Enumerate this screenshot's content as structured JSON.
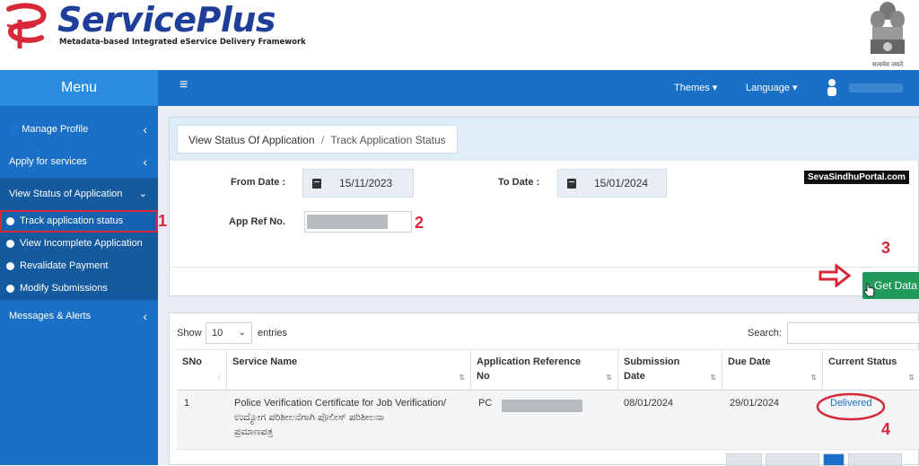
{
  "header": {
    "brand": "ServicePlus",
    "tagline": "Metadata-based Integrated eService Delivery Framework",
    "emblem_text": "सत्यमेव जयते"
  },
  "sidebar": {
    "title": "Menu",
    "items": [
      {
        "label": "Manage Profile"
      },
      {
        "label": "Apply for services"
      },
      {
        "label": "View Status of Application"
      },
      {
        "label": "Messages & Alerts"
      }
    ],
    "subitems": [
      {
        "label": "Track application status"
      },
      {
        "label": "View Incomplete Application"
      },
      {
        "label": "Revalidate Payment"
      },
      {
        "label": "Modify Submissions"
      }
    ]
  },
  "navbar": {
    "hamburger": "≡",
    "themes": "Themes ▾",
    "language": "Language ▾"
  },
  "breadcrumb": {
    "parent": "View Status Of Application",
    "separator": "/",
    "current": "Track Application Status"
  },
  "form": {
    "from_date_label": "From Date :",
    "from_date_value": "15/11/2023",
    "to_date_label": "To Date :",
    "to_date_value": "15/01/2024",
    "app_ref_label": "App Ref No.",
    "get_data_label": "Get Data"
  },
  "annotations": {
    "n1": "1",
    "n2": "2",
    "n3": "3",
    "n4": "4",
    "watermark": "SevaSindhuPortal.com",
    "color": "#d62839"
  },
  "table": {
    "show_label": "Show",
    "entries_value": "10",
    "entries_label": "entries",
    "search_label": "Search:",
    "headers": {
      "sno": "SNo",
      "service": "Service Name",
      "appref_line1": "Application Reference",
      "appref_line2": "No",
      "sub_line1": "Submission",
      "sub_line2": "Date",
      "due": "Due Date",
      "status": "Current Status"
    },
    "rows": [
      {
        "sno": "1",
        "service_line1": "Police Verification Certificate for Job Verification/",
        "service_line2": "ಉದ್ಯೋಗ ಪರಿಶೀಲನೆಗಾಗಿ ಪೊಲೀಸ್ ಪರಿಶೀಲನಾ",
        "service_line3": "ಪ್ರಮಾಣಪತ್ರ",
        "appref_prefix": "PC",
        "submission": "08/01/2024",
        "due": "29/01/2024",
        "status": "Delivered"
      }
    ]
  },
  "colors": {
    "sidebar": "#1a6fc6",
    "accent": "#2a8de0",
    "button": "#1f9a5a"
  }
}
